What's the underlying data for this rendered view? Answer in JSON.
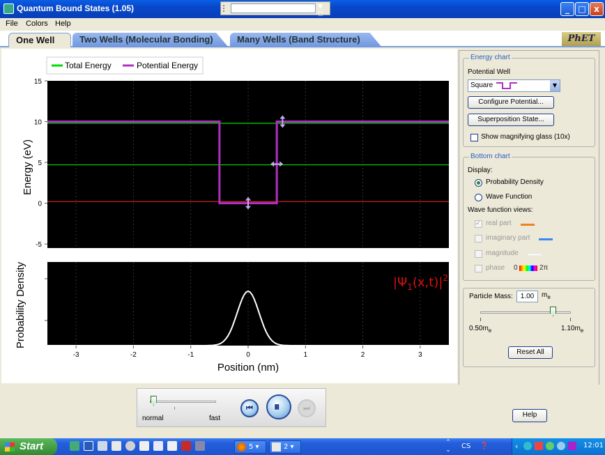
{
  "window": {
    "title": "Quantum Bound States (1.05)",
    "minimize": "_",
    "maximize": "□",
    "close": "x"
  },
  "menu": [
    "File",
    "Colors",
    "Help"
  ],
  "tabs": [
    "One Well",
    "Two Wells (Molecular Bonding)",
    "Many Wells (Band Structure)"
  ],
  "logo": "PhET",
  "energy_chart": {
    "legend": [
      "Total Energy",
      "Potential Energy"
    ],
    "ylabel": "Energy (eV)",
    "yticks": [
      "15",
      "10",
      "5",
      "0",
      "-5"
    ],
    "colors": {
      "total_energy": "#00dd00",
      "potential": "#b030c0",
      "ground": "#cc2222"
    }
  },
  "chart_data": [
    {
      "type": "line",
      "title": "",
      "ylabel": "Energy (eV)",
      "xlabel": "",
      "ylim": [
        -5.5,
        15
      ],
      "xlim": [
        -3.5,
        3.5
      ],
      "series": [
        {
          "name": "Potential Energy",
          "x": [
            -3.5,
            -0.5,
            -0.5,
            0.5,
            0.5,
            3.5
          ],
          "y": [
            10,
            10,
            0,
            0,
            10,
            10
          ]
        },
        {
          "name": "Total Energy",
          "levels": [
            9.8,
            4.7,
            0.2
          ]
        }
      ]
    },
    {
      "type": "line",
      "ylabel": "Probability Density",
      "xlabel": "Position (nm)",
      "xlim": [
        -3.5,
        3.5
      ],
      "xticks": [
        "-3",
        "-2",
        "-1",
        "0",
        "1",
        "2",
        "3"
      ],
      "series": [
        {
          "name": "|Ψ1(x,t)|²",
          "center": 0,
          "width": 0.19,
          "peak": 1
        }
      ]
    }
  ],
  "bottom_chart": {
    "ylabel": "Probability Density",
    "xlabel": "Position (nm)",
    "xticks": [
      "-3",
      "-2",
      "-1",
      "0",
      "1",
      "2",
      "3"
    ],
    "formula_main": "|Ψ",
    "formula_sub": "1",
    "formula_rest": "(x,t)|",
    "formula_sup": "2"
  },
  "panel": {
    "energy_chart_legend": "Energy chart",
    "potential_well_label": "Potential Well",
    "well_type": "Square",
    "configure_button": "Configure Potential...",
    "superposition_button": "Superposition State...",
    "magnifier_label": "Show magnifying glass (10x)",
    "bottom_chart_legend": "Bottom chart",
    "display_label": "Display:",
    "probability_density": "Probability Density",
    "wave_function": "Wave Function",
    "views_label": "Wave function views:",
    "real_part": "real part",
    "imaginary_part": "imaginary part",
    "magnitude": "magnitude",
    "phase": "phase",
    "phase_start": "0",
    "phase_end": "2π",
    "particle_mass_label": "Particle Mass:",
    "particle_mass_value": "1.00",
    "mass_unit": "m",
    "mass_unit_sub": "e",
    "mass_min": "0.50m",
    "mass_max": "1.10m",
    "mass_sub": "e",
    "mass_fraction": 0.8,
    "reset_button": "Reset All",
    "help_button": "Help"
  },
  "clock": {
    "slow": "normal",
    "fast": "fast",
    "speed_fraction": 0.05
  },
  "taskbar": {
    "start": "Start",
    "item1": "5",
    "item2": "2",
    "lang": "CS",
    "time": "12:01"
  }
}
